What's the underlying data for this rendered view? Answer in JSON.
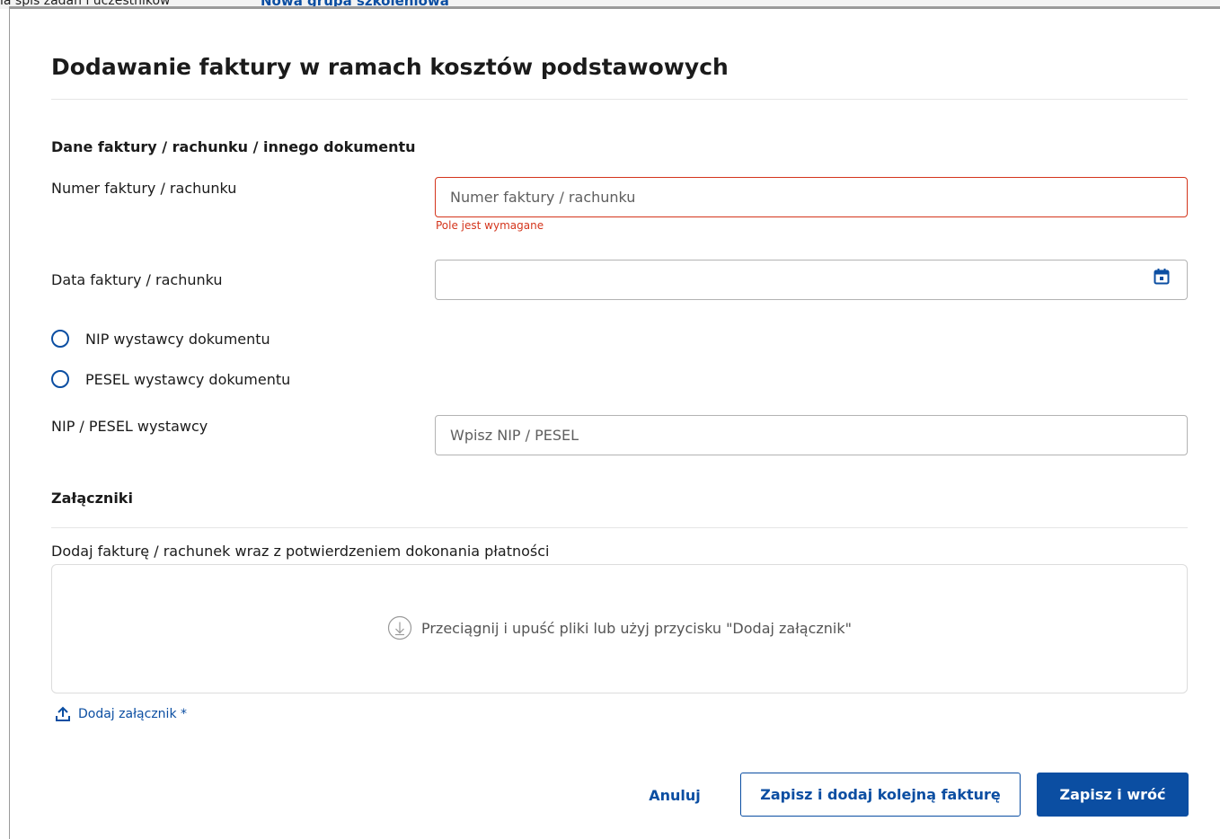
{
  "background": {
    "text": "ia spis zadań i uczestników",
    "link": "Nowa grupa szkoleniowa"
  },
  "modal": {
    "title": "Dodawanie faktury w ramach kosztów podstawowych"
  },
  "invoice_section": {
    "title": "Dane faktury / rachunku / innego dokumentu",
    "invoice_number": {
      "label": "Numer faktury / rachunku",
      "placeholder": "Numer faktury / rachunku",
      "value": "",
      "error": "Pole jest wymagane"
    },
    "invoice_date": {
      "label": "Data faktury / rachunku",
      "value": "",
      "icon": "calendar-icon"
    },
    "issuer_type": {
      "options": [
        {
          "label": "NIP wystawcy dokumentu",
          "selected": false
        },
        {
          "label": "PESEL wystawcy dokumentu",
          "selected": false
        }
      ]
    },
    "issuer_id": {
      "label": "NIP / PESEL wystawcy",
      "placeholder": "Wpisz NIP / PESEL",
      "value": ""
    }
  },
  "attachments_section": {
    "title": "Załączniki",
    "description": "Dodaj fakturę / rachunek wraz z potwierdzeniem dokonania płatności",
    "dropzone_text": "Przeciągnij i upuść pliki lub użyj przycisku \"Dodaj załącznik\"",
    "add_label": "Dodaj załącznik *"
  },
  "actions": {
    "cancel": "Anuluj",
    "save_and_add": "Zapisz i dodaj kolejną fakturę",
    "save_and_return": "Zapisz i wróć"
  },
  "colors": {
    "primary": "#0b4ea2",
    "error": "#d4351c",
    "border": "#b3b3b3"
  }
}
